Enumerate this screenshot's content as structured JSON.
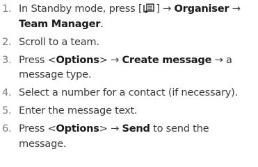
{
  "steps": [
    {
      "number": "1.",
      "parts": [
        {
          "text": "In Standby mode, press [",
          "bold": false
        },
        {
          "icon": "menu-key-icon"
        },
        {
          "text": "] → ",
          "bold": false
        },
        {
          "text": "Organiser",
          "bold": true
        },
        {
          "text": " → ",
          "bold": false
        },
        {
          "text": "Team Manager",
          "bold": true
        },
        {
          "text": ".",
          "bold": false
        }
      ]
    },
    {
      "number": "2.",
      "parts": [
        {
          "text": "Scroll to a team.",
          "bold": false
        }
      ]
    },
    {
      "number": "3.",
      "parts": [
        {
          "text": "Press <",
          "bold": false
        },
        {
          "text": "Options",
          "bold": true
        },
        {
          "text": "> → ",
          "bold": false
        },
        {
          "text": "Create message",
          "bold": true
        },
        {
          "text": " → a message type.",
          "bold": false
        }
      ]
    },
    {
      "number": "4.",
      "parts": [
        {
          "text": "Select a number for a contact (if necessary).",
          "bold": false
        }
      ]
    },
    {
      "number": "5.",
      "parts": [
        {
          "text": "Enter the message text.",
          "bold": false
        }
      ]
    },
    {
      "number": "6.",
      "parts": [
        {
          "text": "Press <",
          "bold": false
        },
        {
          "text": "Options",
          "bold": true
        },
        {
          "text": "> → ",
          "bold": false
        },
        {
          "text": "Send",
          "bold": true
        },
        {
          "text": " to send the message.",
          "bold": false
        }
      ]
    }
  ]
}
